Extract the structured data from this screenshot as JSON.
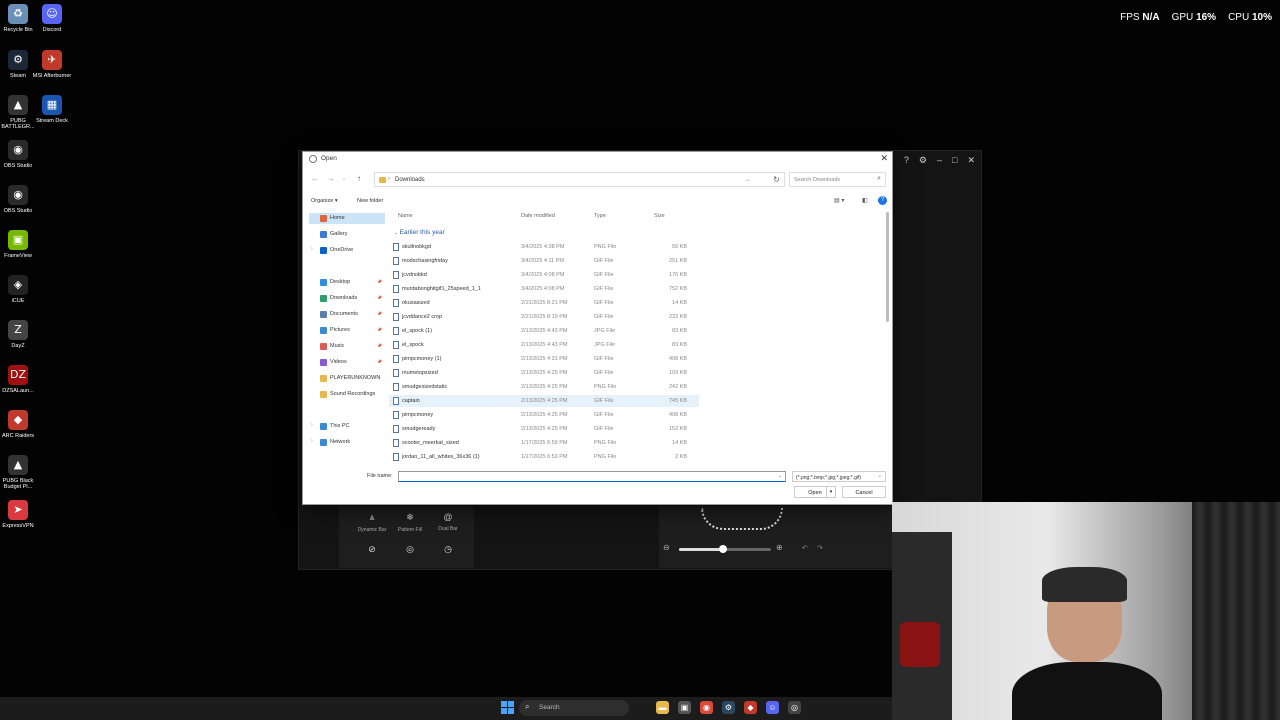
{
  "overlay": {
    "fps_label": "FPS",
    "fps_value": "N/A",
    "gpu_label": "GPU",
    "gpu_value": "16%",
    "cpu_label": "CPU",
    "cpu_value": "10%"
  },
  "desktop_icons": [
    {
      "label": "Recycle Bin",
      "icon": "recycle-bin-icon"
    },
    {
      "label": "Discord",
      "icon": "discord-icon"
    },
    {
      "label": "Steam",
      "icon": "steam-icon"
    },
    {
      "label": "MSI Afterburner",
      "icon": "afterburner-icon"
    },
    {
      "label": "PUBG BATTLEGR...",
      "icon": "pubg-icon"
    },
    {
      "label": "Stream Deck",
      "icon": "stream-deck-icon"
    },
    {
      "label": "OBS Studio",
      "icon": "obs-icon"
    },
    {
      "label": "OBS Studio",
      "icon": "obs-icon"
    },
    {
      "label": "FrameView",
      "icon": "frameview-icon"
    },
    {
      "label": "iCUE",
      "icon": "icue-icon"
    },
    {
      "label": "DayZ",
      "icon": "dayz-icon"
    },
    {
      "label": "DZSALaun...",
      "icon": "dzsa-icon"
    },
    {
      "label": "ARC Raiders",
      "icon": "arc-raiders-icon"
    },
    {
      "label": "PUBG Black Budget Pl...",
      "icon": "pubg-black-budget-icon"
    },
    {
      "label": "ExpressVPN",
      "icon": "expressvpn-icon"
    }
  ],
  "bg_app": {
    "tools": [
      "Dynamic Bar",
      "Pattern Fill",
      "Dual Bar"
    ],
    "slider_level": 0.48
  },
  "dialog": {
    "title": "Open",
    "address": "Downloads",
    "search_placeholder": "Search Downloads",
    "organize": "Organize ▾",
    "new_folder": "New folder",
    "sidebar": [
      {
        "label": "Home",
        "icon": "home-icon",
        "color": "#e0653a",
        "selected": true
      },
      {
        "label": "Gallery",
        "icon": "gallery-icon",
        "color": "#3a7bd5"
      },
      {
        "label": "OneDrive",
        "icon": "onedrive-icon",
        "color": "#0a64c8",
        "expand": true
      },
      {
        "label": "Desktop",
        "icon": "desktop-icon",
        "color": "#2f8ee0",
        "pin": true
      },
      {
        "label": "Downloads",
        "icon": "downloads-icon",
        "color": "#2aa06a",
        "pin": true
      },
      {
        "label": "Documents",
        "icon": "documents-icon",
        "color": "#5a7fb0",
        "pin": true
      },
      {
        "label": "Pictures",
        "icon": "pictures-icon",
        "color": "#3a8ad0",
        "pin": true
      },
      {
        "label": "Music",
        "icon": "music-icon",
        "color": "#e05a5a",
        "pin": true
      },
      {
        "label": "Videos",
        "icon": "videos-icon",
        "color": "#8a5ad0",
        "pin": true
      },
      {
        "label": "PLAYERUNKNOWN",
        "icon": "folder-icon",
        "color": "#e8b84a"
      },
      {
        "label": "Sound Recordings",
        "icon": "folder-icon",
        "color": "#e8b84a"
      },
      {
        "label": "This PC",
        "icon": "this-pc-icon",
        "color": "#3a8ad0",
        "expand": true
      },
      {
        "label": "Network",
        "icon": "network-icon",
        "color": "#3a8ad0",
        "expand": true
      }
    ],
    "columns": {
      "name": "Name",
      "date": "Date modified",
      "type": "Type",
      "size": "Size"
    },
    "group": "Earlier this year",
    "files": [
      {
        "name": "skullnobkgd",
        "date": "3/4/2025 4:38 PM",
        "type": "PNG File",
        "size": "56 KB"
      },
      {
        "name": "modschasingfriday",
        "date": "3/4/2025 4:11 PM",
        "type": "GIF File",
        "size": "251 KB"
      },
      {
        "name": "jcvdnobkd",
        "date": "3/4/2025 4:08 PM",
        "type": "GIF File",
        "size": "176 KB"
      },
      {
        "name": "murdabonghitgif1_25speed_1_1",
        "date": "3/4/2025 4:08 PM",
        "type": "GIF File",
        "size": "752 KB"
      },
      {
        "name": "okusasized",
        "date": "2/21/2025 8:21 PM",
        "type": "GIF File",
        "size": "14 KB"
      },
      {
        "name": "jcvddance2 crop",
        "date": "2/21/2025 8:19 PM",
        "type": "GIF File",
        "size": "232 KB"
      },
      {
        "name": "el_spock (1)",
        "date": "2/13/2025 4:43 PM",
        "type": "JPG File",
        "size": "83 KB"
      },
      {
        "name": "el_spock",
        "date": "2/13/2025 4:43 PM",
        "type": "JPG File",
        "size": "83 KB"
      },
      {
        "name": "pimpcmoney (1)",
        "date": "2/13/2025 4:31 PM",
        "type": "GIF File",
        "size": "408 KB"
      },
      {
        "name": "mumetopsized",
        "date": "2/13/2025 4:25 PM",
        "type": "GIF File",
        "size": "103 KB"
      },
      {
        "name": "smudgesizedstatic",
        "date": "2/13/2025 4:25 PM",
        "type": "PNG File",
        "size": "242 KB"
      },
      {
        "name": "captain",
        "date": "2/13/2025 4:25 PM",
        "type": "GIF File",
        "size": "745 KB",
        "highlight": true
      },
      {
        "name": "pimpcmoney",
        "date": "2/13/2025 4:25 PM",
        "type": "GIF File",
        "size": "408 KB"
      },
      {
        "name": "smudgeready",
        "date": "2/13/2025 4:25 PM",
        "type": "GIF File",
        "size": "152 KB"
      },
      {
        "name": "scooter_meerkat_sized",
        "date": "1/17/2025 6:59 PM",
        "type": "PNG File",
        "size": "14 KB"
      },
      {
        "name": "jordan_11_all_whites_36x36 (1)",
        "date": "1/17/2025 6:53 PM",
        "type": "PNG File",
        "size": "2 KB"
      }
    ],
    "filename_label": "File name:",
    "filename_value": "",
    "filter": "(*.png;*.bmp;*.jpg;*.jpeg;*.gif)",
    "open": "Open",
    "cancel": "Cancel"
  },
  "taskbar": {
    "search_placeholder": "Search",
    "apps": [
      {
        "icon": "file-explorer-icon",
        "color": "#e8b84a"
      },
      {
        "icon": "task-view-icon",
        "color": "#555"
      },
      {
        "icon": "chrome-icon",
        "color": "#d94a3a"
      },
      {
        "icon": "steam-icon",
        "color": "#2a475e"
      },
      {
        "icon": "app-icon",
        "color": "#c0392b"
      },
      {
        "icon": "discord-icon",
        "color": "#5865f2"
      },
      {
        "icon": "obs-icon",
        "color": "#444"
      }
    ]
  }
}
